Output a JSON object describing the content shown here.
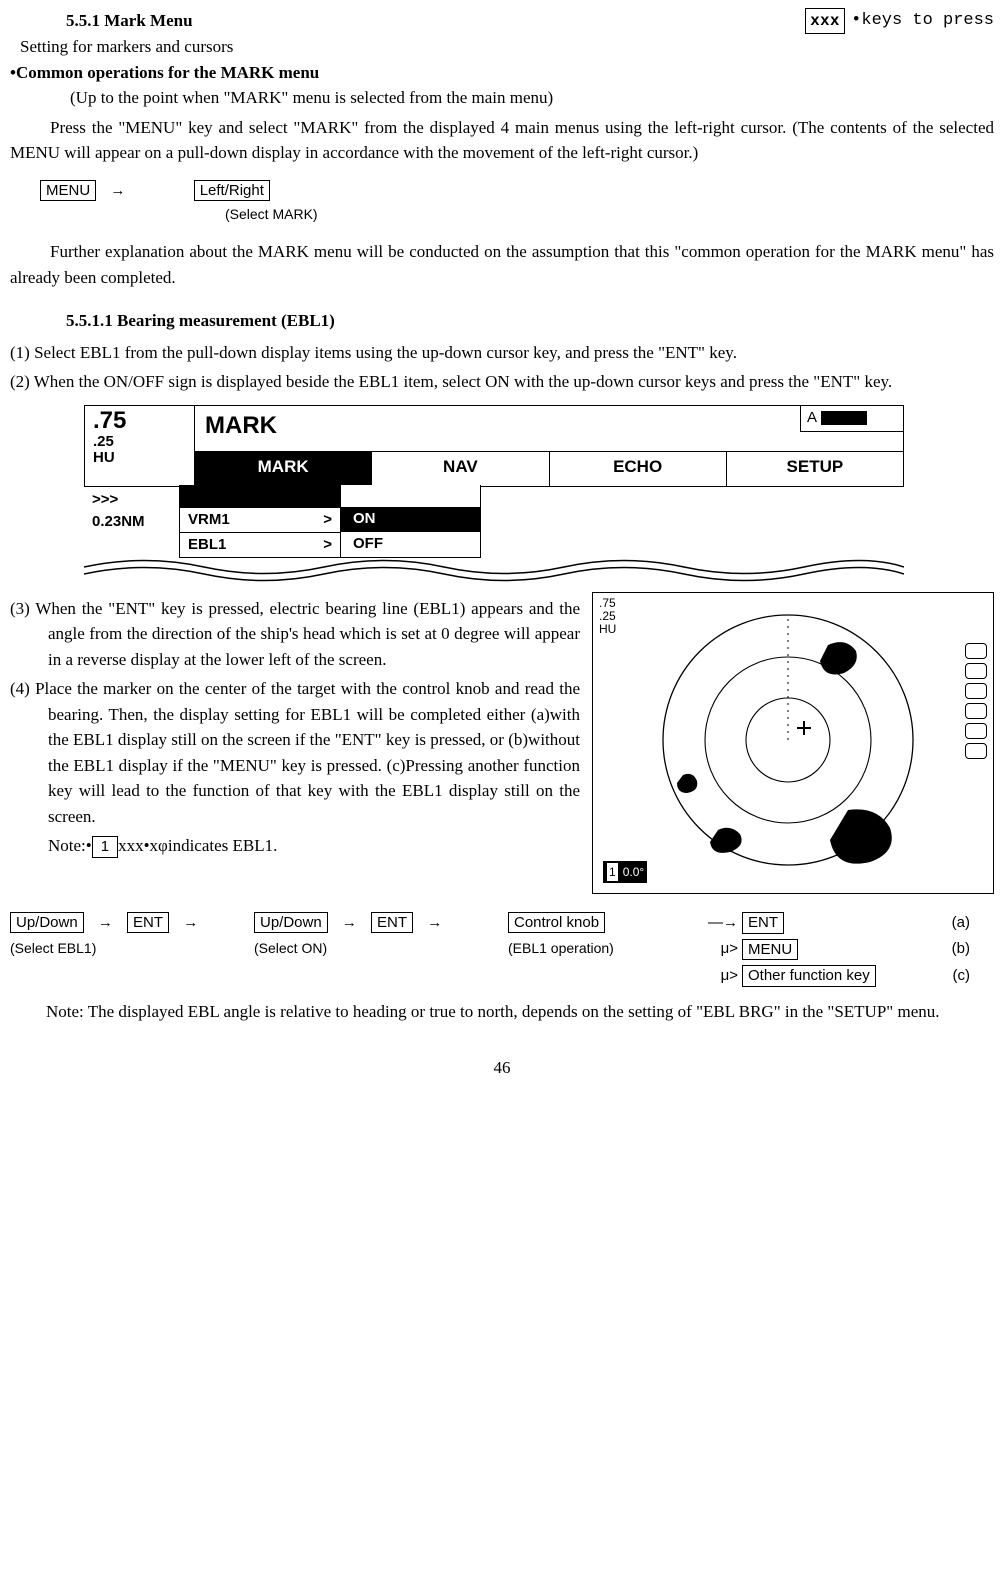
{
  "legend": {
    "xxx": "xxx",
    "label": "•keys to press"
  },
  "h1": "5.5.1 Mark Menu",
  "subtitle": "Setting for markers and cursors",
  "h2": "•Common operations for the MARK menu",
  "p_upto": "(Up to the point when \"MARK\" menu is selected from the main menu)",
  "p1": "Press the \"MENU\" key and select \"MARK\" from the displayed 4 main menus using the left-right cursor.  (The contents of the selected MENU will appear on a pull-down display in accordance with the movement of the left-right cursor.)",
  "seq1": {
    "menu": "MENU",
    "arrow": "→",
    "lr": "Left/Right",
    "sub": "(Select MARK)"
  },
  "p2": "Further explanation about the MARK menu will be conducted on the assumption that this \"common operation for the MARK menu\" has already been completed.",
  "h3": "5.5.1.1 Bearing measurement (EBL1)",
  "step1": "(1)  Select EBL1 from the pull-down display items using the up-down cursor key, and press the \"ENT\" key.",
  "step2": "(2)  When the ON/OFF sign is displayed beside the EBL1 item, select ON with the up-down cursor keys and press the \"ENT\" key.",
  "d1": {
    "range": ".75",
    "range2": ".25",
    "mode": "HU",
    "title": "MARK",
    "tabs": [
      "MARK",
      "NAV",
      "ECHO",
      "SETUP"
    ],
    "a": "A",
    "below": {
      "chev": ">>>",
      "nm": "0.23NM"
    },
    "items": [
      {
        "label": "VRM1",
        "gt": ">"
      },
      {
        "label": "EBL1",
        "gt": ">"
      }
    ],
    "opts": {
      "on": "ON",
      "off": "OFF"
    }
  },
  "step3": "(3)  When the \"ENT\" key is pressed, electric bearing line (EBL1) appears and the angle from the direction of the ship's head which is set at 0 degree will appear in a reverse display at the lower left of the screen.",
  "step4": "(4)  Place the marker on the center of the target with the control knob and read the bearing.  Then, the display setting for EBL1 will be completed either (a)with the EBL1 display still on the screen if the \"ENT\" key is pressed, or (b)without the EBL1 display if the \"MENU\" key is pressed.  (c)Pressing another function key will lead to the function of that key with the EBL1 display still on the screen.",
  "note_box": {
    "pre": "Note:•",
    "one": "1",
    "post": "xxx•xφindicates EBL1."
  },
  "d2": {
    "r1": ".75",
    "r2": ".25",
    "r3": "HU",
    "brg_num": "1",
    "brg_val": "0.0°"
  },
  "seq2": {
    "col1": {
      "k1": "Up/Down",
      "a": "→",
      "k2": "ENT",
      "a2": "→",
      "sub": "(Select EBL1)"
    },
    "col2": {
      "k1": "Up/Down",
      "a": "→",
      "k2": "ENT",
      "a2": "→",
      "sub": "(Select ON)"
    },
    "col3": {
      "k1": "Control knob",
      "a_ent": "—→",
      "sub": "(EBL1 operation)"
    },
    "opts": {
      "a": {
        "lead": "",
        "key": "ENT",
        "lab": "(a)"
      },
      "b": {
        "lead": "μ>",
        "key": "MENU",
        "lab": "(b)"
      },
      "c": {
        "lead": "μ>",
        "key": "Other function key",
        "lab": "(c)"
      }
    }
  },
  "footnote": "Note: The displayed EBL angle is relative to heading or true to north, depends on the setting of \"EBL BRG\" in the \"SETUP\" menu.",
  "pagenum": "46"
}
